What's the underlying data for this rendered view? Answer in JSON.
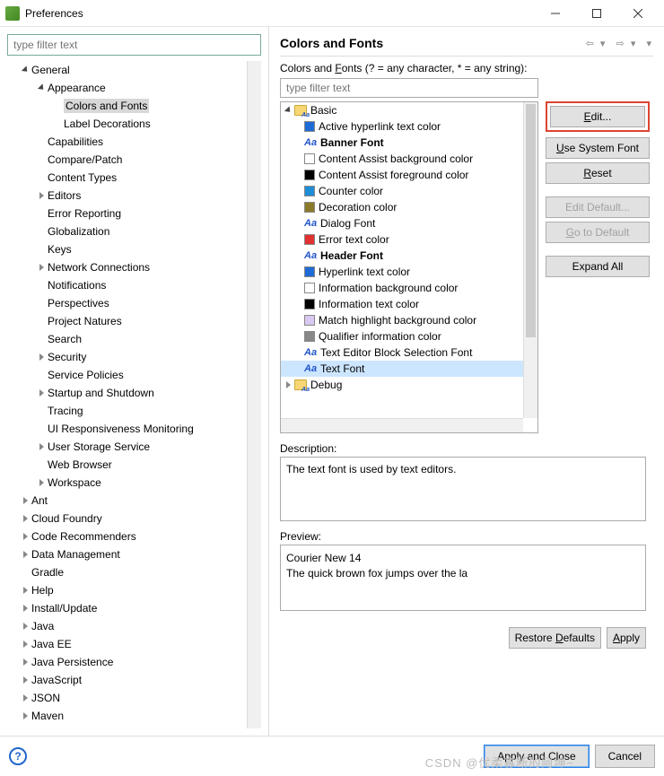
{
  "window": {
    "title": "Preferences"
  },
  "filter_placeholder": "type filter text",
  "tree": [
    {
      "lbl": "General",
      "d": 1,
      "exp": true,
      "open": true
    },
    {
      "lbl": "Appearance",
      "d": 2,
      "exp": true,
      "open": true
    },
    {
      "lbl": "Colors and Fonts",
      "d": 3,
      "sel": true
    },
    {
      "lbl": "Label Decorations",
      "d": 3
    },
    {
      "lbl": "Capabilities",
      "d": 2
    },
    {
      "lbl": "Compare/Patch",
      "d": 2
    },
    {
      "lbl": "Content Types",
      "d": 2
    },
    {
      "lbl": "Editors",
      "d": 2,
      "exp": true
    },
    {
      "lbl": "Error Reporting",
      "d": 2
    },
    {
      "lbl": "Globalization",
      "d": 2
    },
    {
      "lbl": "Keys",
      "d": 2
    },
    {
      "lbl": "Network Connections",
      "d": 2,
      "exp": true
    },
    {
      "lbl": "Notifications",
      "d": 2
    },
    {
      "lbl": "Perspectives",
      "d": 2
    },
    {
      "lbl": "Project Natures",
      "d": 2
    },
    {
      "lbl": "Search",
      "d": 2
    },
    {
      "lbl": "Security",
      "d": 2,
      "exp": true
    },
    {
      "lbl": "Service Policies",
      "d": 2
    },
    {
      "lbl": "Startup and Shutdown",
      "d": 2,
      "exp": true
    },
    {
      "lbl": "Tracing",
      "d": 2
    },
    {
      "lbl": "UI Responsiveness Monitoring",
      "d": 2
    },
    {
      "lbl": "User Storage Service",
      "d": 2,
      "exp": true
    },
    {
      "lbl": "Web Browser",
      "d": 2
    },
    {
      "lbl": "Workspace",
      "d": 2,
      "exp": true
    },
    {
      "lbl": "Ant",
      "d": 1,
      "exp": true
    },
    {
      "lbl": "Cloud Foundry",
      "d": 1,
      "exp": true
    },
    {
      "lbl": "Code Recommenders",
      "d": 1,
      "exp": true
    },
    {
      "lbl": "Data Management",
      "d": 1,
      "exp": true
    },
    {
      "lbl": "Gradle",
      "d": 1
    },
    {
      "lbl": "Help",
      "d": 1,
      "exp": true
    },
    {
      "lbl": "Install/Update",
      "d": 1,
      "exp": true
    },
    {
      "lbl": "Java",
      "d": 1,
      "exp": true
    },
    {
      "lbl": "Java EE",
      "d": 1,
      "exp": true
    },
    {
      "lbl": "Java Persistence",
      "d": 1,
      "exp": true
    },
    {
      "lbl": "JavaScript",
      "d": 1,
      "exp": true
    },
    {
      "lbl": "JSON",
      "d": 1,
      "exp": true
    },
    {
      "lbl": "Maven",
      "d": 1,
      "exp": true
    }
  ],
  "page": {
    "heading": "Colors and Fonts",
    "instruction_prefix": "Colors and ",
    "instruction_u": "F",
    "instruction_suffix": "onts (? = any character, * = any string):",
    "rfilter_placeholder": "type filter text"
  },
  "list": [
    {
      "lbl": "Basic",
      "d": 1,
      "exp": true,
      "open": true,
      "icon": "folder"
    },
    {
      "lbl": "Active hyperlink text color",
      "d": 2,
      "icon": "swatch",
      "color": "#1f6bd6"
    },
    {
      "lbl": "Banner Font",
      "d": 2,
      "icon": "aa",
      "bold": true
    },
    {
      "lbl": "Content Assist background color",
      "d": 2,
      "icon": "swatch",
      "color": "#ffffff"
    },
    {
      "lbl": "Content Assist foreground color",
      "d": 2,
      "icon": "swatch",
      "color": "#000000"
    },
    {
      "lbl": "Counter color",
      "d": 2,
      "icon": "swatch",
      "color": "#1f8dd6"
    },
    {
      "lbl": "Decoration color",
      "d": 2,
      "icon": "swatch",
      "color": "#8a7a2a"
    },
    {
      "lbl": "Dialog Font",
      "d": 2,
      "icon": "aa"
    },
    {
      "lbl": "Error text color",
      "d": 2,
      "icon": "swatch",
      "color": "#e03030"
    },
    {
      "lbl": "Header Font",
      "d": 2,
      "icon": "aa",
      "bold": true
    },
    {
      "lbl": "Hyperlink text color",
      "d": 2,
      "icon": "swatch",
      "color": "#1f6bd6"
    },
    {
      "lbl": "Information background color",
      "d": 2,
      "icon": "swatch",
      "color": "#ffffff"
    },
    {
      "lbl": "Information text color",
      "d": 2,
      "icon": "swatch",
      "color": "#000000"
    },
    {
      "lbl": "Match highlight background color",
      "d": 2,
      "icon": "swatch",
      "color": "#d9c8f2"
    },
    {
      "lbl": "Qualifier information color",
      "d": 2,
      "icon": "swatch",
      "color": "#888888"
    },
    {
      "lbl": "Text Editor Block Selection Font",
      "d": 2,
      "icon": "aa",
      "mono": true
    },
    {
      "lbl": "Text Font",
      "d": 2,
      "icon": "aa",
      "mono": true,
      "sel": true
    },
    {
      "lbl": "Debug",
      "d": 1,
      "exp": true,
      "icon": "folder"
    }
  ],
  "buttons": {
    "edit": "Edit...",
    "use_system": "Use System Font",
    "reset": "Reset",
    "edit_default": "Edit Default...",
    "go_default": "Go to Default",
    "expand_all": "Expand All"
  },
  "description": {
    "label": "Description:",
    "text": "The text font is used by text editors."
  },
  "preview": {
    "label": "Preview:",
    "line1": "Courier New 14",
    "line2": "The quick brown fox jumps over the la"
  },
  "footer": {
    "restore": "Restore Defaults",
    "apply": "Apply",
    "apply_close": "Apply and Close",
    "cancel": "Cancel"
  },
  "watermark": "CSDN @优柔寡断的阿坤~"
}
